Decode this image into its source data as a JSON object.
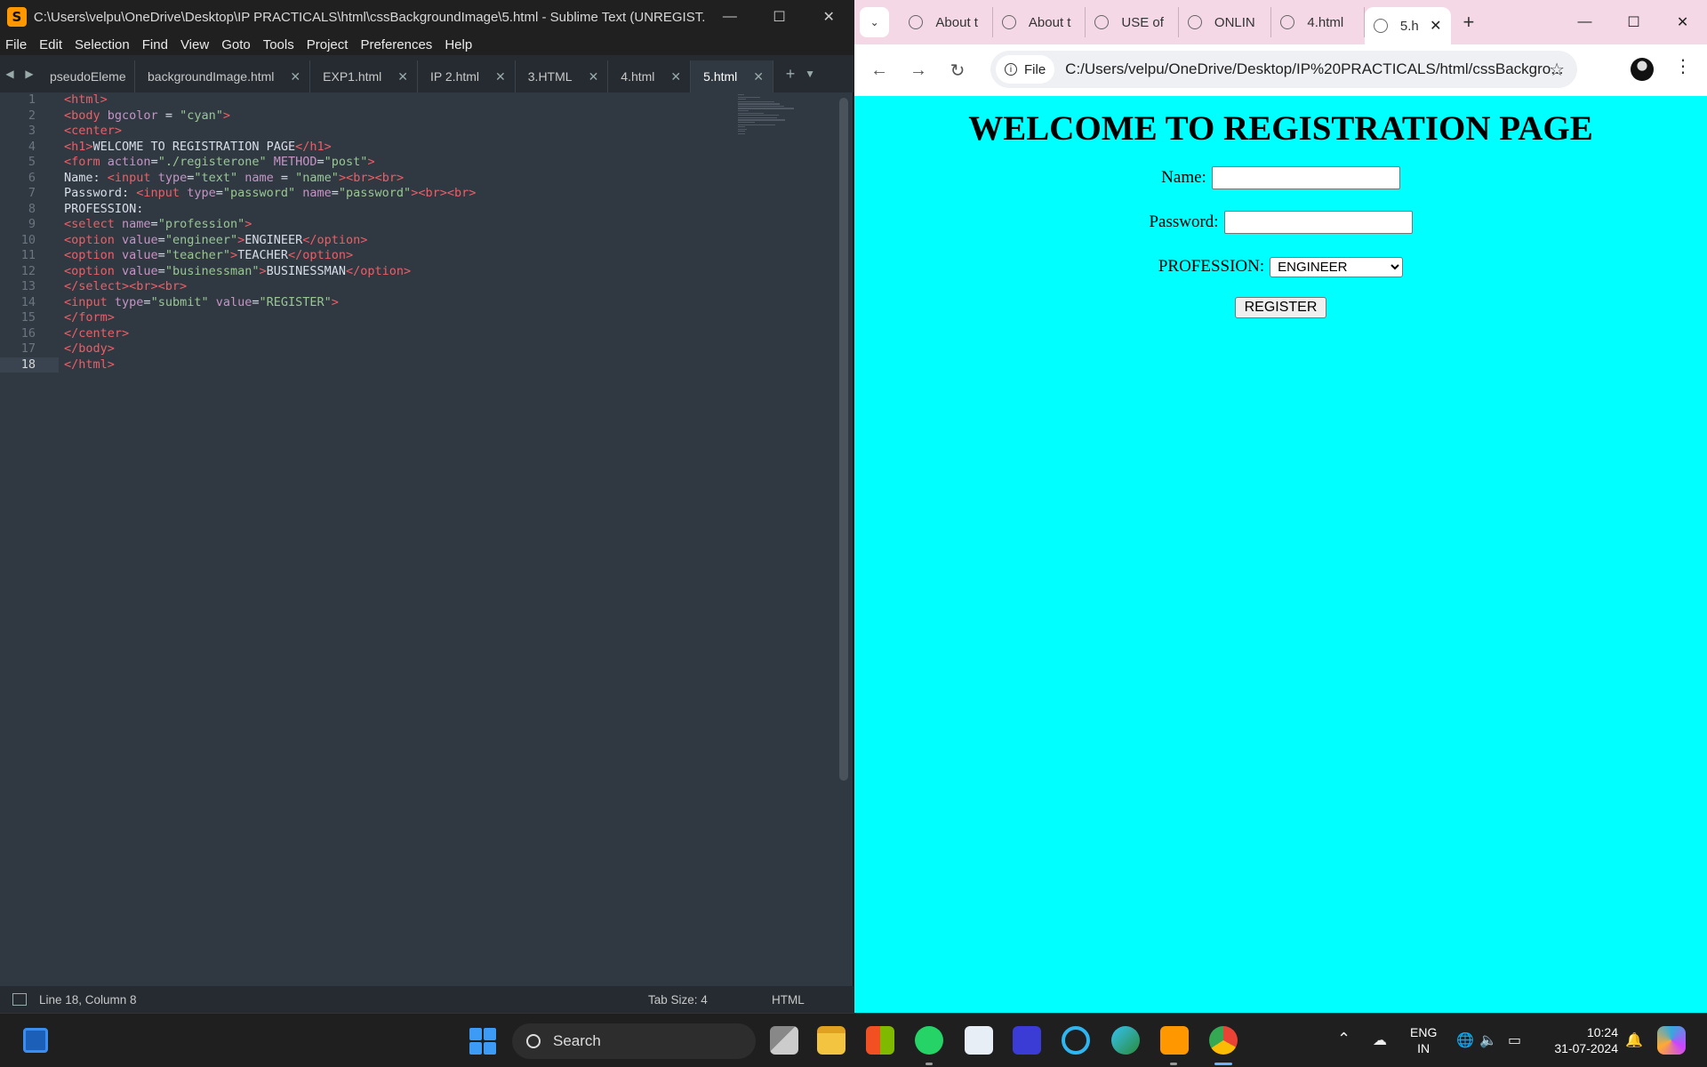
{
  "sublime": {
    "title": "C:\\Users\\velpu\\OneDrive\\Desktop\\IP PRACTICALS\\html\\cssBackgroundImage\\5.html - Sublime Text (UNREGIST...",
    "menu": [
      "File",
      "Edit",
      "Selection",
      "Find",
      "View",
      "Goto",
      "Tools",
      "Project",
      "Preferences",
      "Help"
    ],
    "tabs": [
      {
        "label": "pseudoElements.htm"
      },
      {
        "label": "backgroundImage.html"
      },
      {
        "label": "EXP1.html"
      },
      {
        "label": "IP 2.html"
      },
      {
        "label": "3.HTML"
      },
      {
        "label": "4.html"
      },
      {
        "label": "5.html"
      }
    ],
    "current_line": 18,
    "code": [
      [
        "1",
        [
          [
            "t",
            "<html>"
          ]
        ]
      ],
      [
        "2",
        [
          [
            "t",
            "<body "
          ],
          [
            "a",
            "bgcolor"
          ],
          [
            "x",
            " = "
          ],
          [
            "s",
            "\"cyan\""
          ],
          [
            "t",
            ">"
          ]
        ]
      ],
      [
        "3",
        [
          [
            "t",
            "<center>"
          ]
        ]
      ],
      [
        "4",
        [
          [
            "t",
            "<h1>"
          ],
          [
            "x",
            "WELCOME TO REGISTRATION PAGE"
          ],
          [
            "t",
            "</h1>"
          ]
        ]
      ],
      [
        "5",
        [
          [
            "t",
            "<form "
          ],
          [
            "a",
            "action"
          ],
          [
            "x",
            "="
          ],
          [
            "s",
            "\"./registerone\""
          ],
          [
            "a",
            " METHOD"
          ],
          [
            "x",
            "="
          ],
          [
            "s",
            "\"post\""
          ],
          [
            "t",
            ">"
          ]
        ]
      ],
      [
        "6",
        [
          [
            "x",
            "Name: "
          ],
          [
            "t",
            "<input "
          ],
          [
            "a",
            "type"
          ],
          [
            "x",
            "="
          ],
          [
            "s",
            "\"text\""
          ],
          [
            "a",
            " name"
          ],
          [
            "x",
            " = "
          ],
          [
            "s",
            "\"name\""
          ],
          [
            "t",
            "><br><br>"
          ]
        ]
      ],
      [
        "7",
        [
          [
            "x",
            "Password: "
          ],
          [
            "t",
            "<input "
          ],
          [
            "a",
            "type"
          ],
          [
            "x",
            "="
          ],
          [
            "s",
            "\"password\""
          ],
          [
            "a",
            " name"
          ],
          [
            "x",
            "="
          ],
          [
            "s",
            "\"password\""
          ],
          [
            "t",
            "><br><br>"
          ]
        ]
      ],
      [
        "8",
        [
          [
            "x",
            "PROFESSION:"
          ]
        ]
      ],
      [
        "9",
        [
          [
            "t",
            "<select "
          ],
          [
            "a",
            "name"
          ],
          [
            "x",
            "="
          ],
          [
            "s",
            "\"profession\""
          ],
          [
            "t",
            ">"
          ]
        ]
      ],
      [
        "10",
        [
          [
            "t",
            "<option "
          ],
          [
            "a",
            "value"
          ],
          [
            "x",
            "="
          ],
          [
            "s",
            "\"engineer\""
          ],
          [
            "t",
            ">"
          ],
          [
            "x",
            "ENGINEER"
          ],
          [
            "t",
            "</option>"
          ]
        ]
      ],
      [
        "11",
        [
          [
            "t",
            "<option "
          ],
          [
            "a",
            "value"
          ],
          [
            "x",
            "="
          ],
          [
            "s",
            "\"teacher\""
          ],
          [
            "t",
            ">"
          ],
          [
            "x",
            "TEACHER"
          ],
          [
            "t",
            "</option>"
          ]
        ]
      ],
      [
        "12",
        [
          [
            "t",
            "<option "
          ],
          [
            "a",
            "value"
          ],
          [
            "x",
            "="
          ],
          [
            "s",
            "\"businessman\""
          ],
          [
            "t",
            ">"
          ],
          [
            "x",
            "BUSINESSMAN"
          ],
          [
            "t",
            "</option>"
          ]
        ]
      ],
      [
        "13",
        [
          [
            "t",
            "</select><br><br>"
          ]
        ]
      ],
      [
        "14",
        [
          [
            "t",
            "<input "
          ],
          [
            "a",
            "type"
          ],
          [
            "x",
            "="
          ],
          [
            "s",
            "\"submit\""
          ],
          [
            "a",
            " value"
          ],
          [
            "x",
            "="
          ],
          [
            "s",
            "\"REGISTER\""
          ],
          [
            "t",
            ">"
          ]
        ]
      ],
      [
        "15",
        [
          [
            "t",
            "</form>"
          ]
        ]
      ],
      [
        "16",
        [
          [
            "t",
            "</center>"
          ]
        ]
      ],
      [
        "17",
        [
          [
            "t",
            "</body>"
          ]
        ]
      ],
      [
        "18",
        [
          [
            "t",
            "</html>"
          ]
        ]
      ]
    ],
    "status": {
      "position": "Line 18, Column 8",
      "tab_size": "Tab Size: 4",
      "syntax": "HTML"
    }
  },
  "chrome": {
    "tabs": [
      {
        "label": "About t"
      },
      {
        "label": "About t"
      },
      {
        "label": "USE of"
      },
      {
        "label": "ONLIN"
      },
      {
        "label": "4.html"
      },
      {
        "label": "5.h"
      }
    ],
    "file_chip": "File",
    "url": "C:/Users/velpu/OneDrive/Desktop/IP%20PRACTICALS/html/cssBackgro...",
    "page": {
      "background": "#00ffff",
      "heading": "WELCOME TO REGISTRATION PAGE",
      "name_label": "Name:",
      "password_label": "Password:",
      "profession_label": "PROFESSION:",
      "profession_selected": "ENGINEER",
      "register_label": "REGISTER"
    }
  },
  "taskbar": {
    "search_label": "Search",
    "lang_line1": "ENG",
    "lang_line2": "IN",
    "time": "10:24",
    "date": "31-07-2024"
  }
}
